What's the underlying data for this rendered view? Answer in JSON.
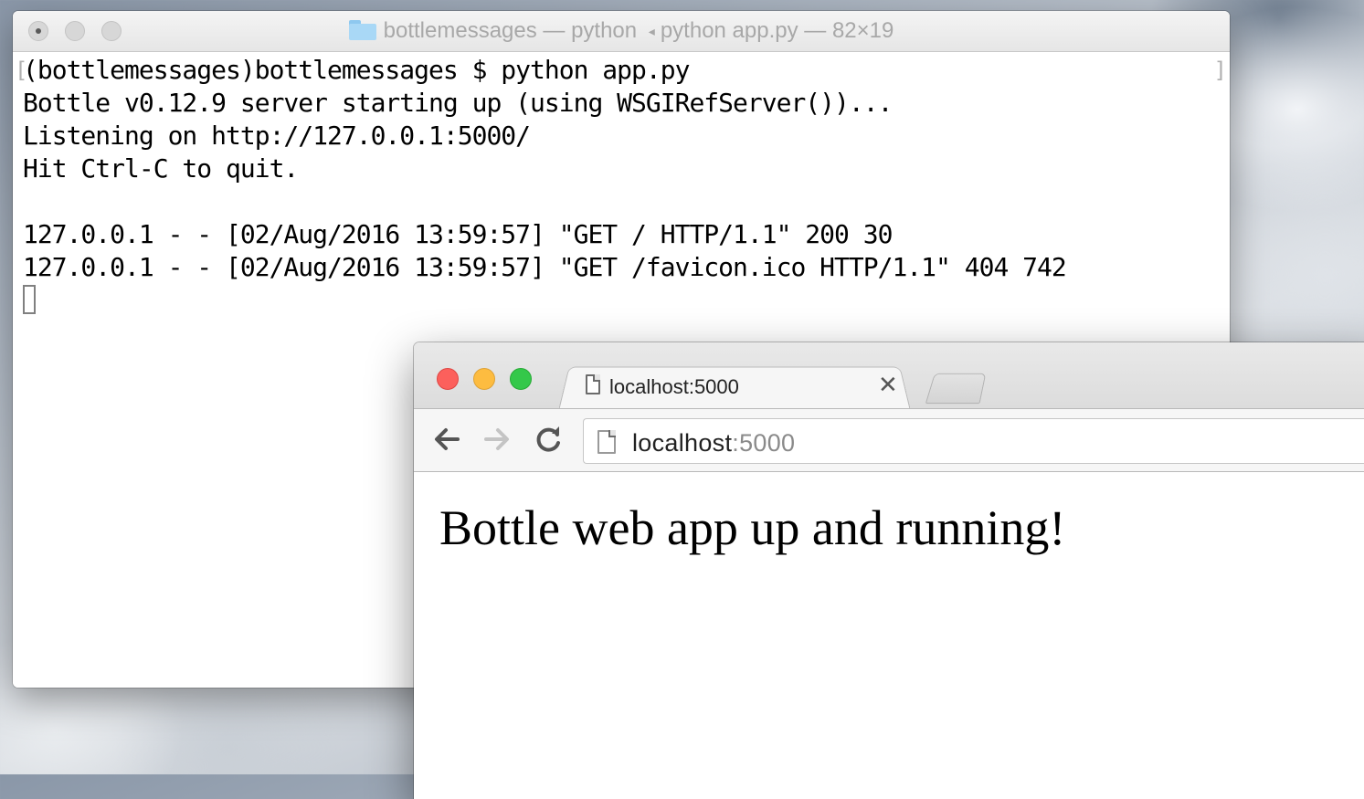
{
  "terminal": {
    "title_folder": "bottlemessages",
    "title_rest": " — python ",
    "title_process": "python app.py — 82×19",
    "lines": [
      "(bottlemessages)bottlemessages $ python app.py",
      "Bottle v0.12.9 server starting up (using WSGIRefServer())...",
      "Listening on http://127.0.0.1:5000/",
      "Hit Ctrl-C to quit.",
      "",
      "127.0.0.1 - - [02/Aug/2016 13:59:57] \"GET / HTTP/1.1\" 200 30",
      "127.0.0.1 - - [02/Aug/2016 13:59:57] \"GET /favicon.ico HTTP/1.1\" 404 742"
    ]
  },
  "browser": {
    "tab": {
      "title": "localhost:5000",
      "close_glyph": "✕"
    },
    "nav": {
      "back_glyph": "🡐",
      "forward_glyph": "🡒",
      "reload_glyph": "↻"
    },
    "address": {
      "host": "localhost",
      "port": ":5000"
    },
    "page": {
      "heading": "Bottle web app up and running!"
    }
  },
  "colors": {
    "close": "#fc605c",
    "minimize": "#fdbc40",
    "maximize": "#34c84a"
  }
}
